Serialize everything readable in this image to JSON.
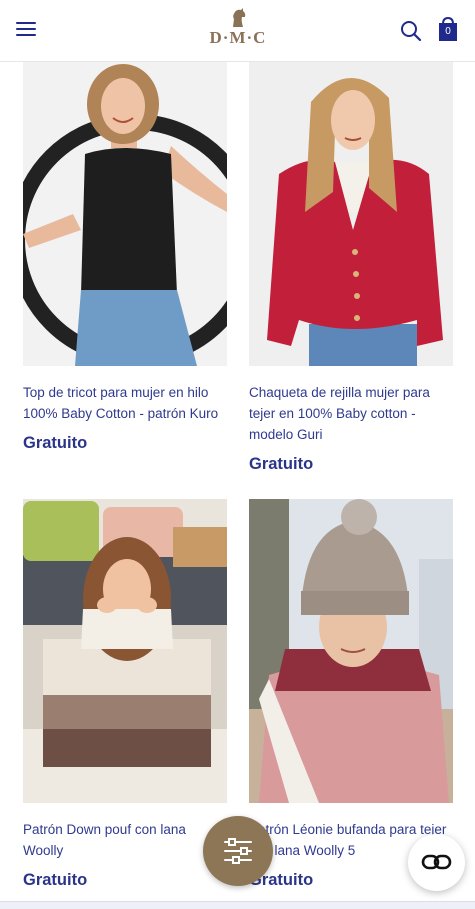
{
  "header": {
    "logo_text": "D·M·C",
    "bag_count": "0",
    "icons": {
      "menu": "hamburger-menu-icon",
      "search": "search-icon",
      "bag": "shopping-bag-icon"
    }
  },
  "products": [
    {
      "title": "Top de tricot para mujer en hilo 100% Baby Cotton - patrón Kuro",
      "price": "Gratuito"
    },
    {
      "title": "Chaqueta de rejilla mujer para tejer en 100% Baby cotton - modelo Guri",
      "price": "Gratuito"
    },
    {
      "title": "Patrón Down pouf con lana Woolly",
      "price": "Gratuito"
    },
    {
      "title": "Patrón Léonie bufanda para tejer con lana Woolly 5",
      "price": "Gratuito"
    }
  ],
  "fabs": {
    "filter_icon": "filter-sliders-icon",
    "chat_icon": "chat-link-icon"
  },
  "colors": {
    "brand_blue": "#2f3a8f",
    "brand_gold": "#8d7656"
  }
}
